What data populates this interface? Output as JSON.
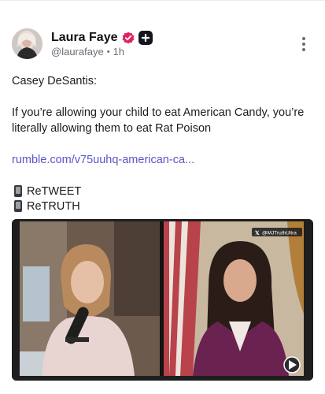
{
  "post": {
    "author_name": "Laura Faye",
    "handle": "@laurafaye",
    "separator": "•",
    "time": "1h",
    "intro": "Casey DeSantis:",
    "body": "If you’re allowing your child to eat American Candy, you’re literally allowing them to eat Rat Poison",
    "link": "rumble.com/v75uuhq-american-ca...",
    "retweet": "ReTWEET",
    "retruth": "ReTRUTH"
  },
  "media": {
    "watermark": "@MJTruthUltra",
    "play_badge_icon": "rumble-play-icon"
  },
  "icons": {
    "verified": "verified-badge-icon",
    "plus": "plus-badge-icon",
    "more": "more-vertical-icon",
    "phone": "mobile-phone-icon"
  },
  "colors": {
    "verified": "#e0245e",
    "link": "#5a55c8",
    "handle": "#6b6b75"
  }
}
